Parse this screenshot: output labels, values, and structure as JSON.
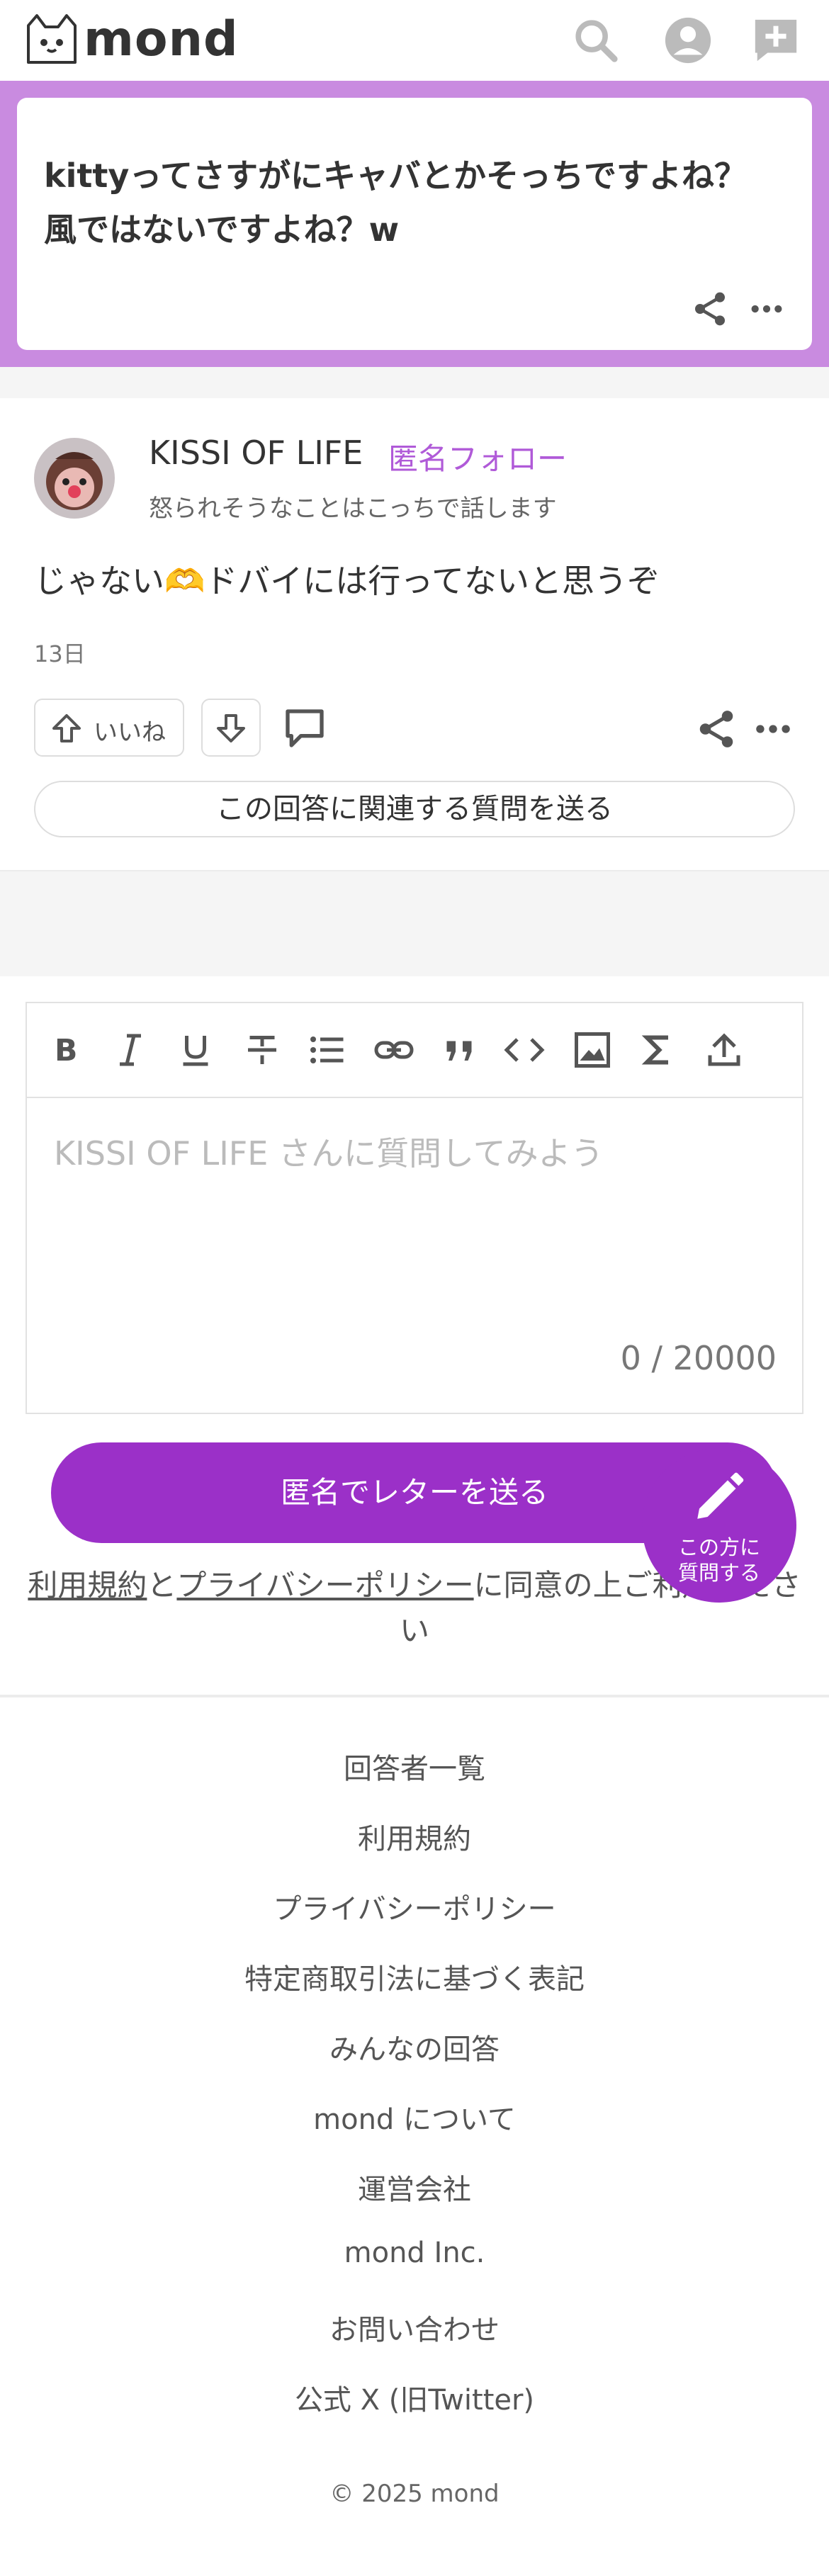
{
  "header": {
    "logo_text": "mond",
    "icons": [
      "search-icon",
      "account-icon",
      "new-question-icon"
    ]
  },
  "question": {
    "line1": "kittyってさすがにキャバとかそっちですよね？",
    "line2": "風ではないですよね？w"
  },
  "answer": {
    "name": "KISSI OF LIFE",
    "follow_label": "匿名フォロー",
    "bio": "怒られそうなことはこっちで話します",
    "text": "じゃない🫶ドバイには行ってないと思うぞ",
    "date": "13日",
    "like_label": "いいね",
    "related_button": "この回答に関連する質問を送る"
  },
  "editor": {
    "toolbar": [
      "bold-icon",
      "italic-icon",
      "underline-icon",
      "strikethrough-icon",
      "bullet-list-icon",
      "link-icon",
      "quote-icon",
      "code-icon",
      "image-icon",
      "sigma-icon",
      "upload-icon"
    ],
    "placeholder": "KISSI OF LIFE さんに質問してみよう",
    "counter": "0 / 20000"
  },
  "send_button": "匿名でレターを送る",
  "agreement": {
    "terms": "利用規約",
    "and": "と",
    "privacy": "プライバシーポリシー",
    "rest": "に同意の上ご利用ください"
  },
  "fab": {
    "line1": "この方に",
    "line2": "質問する"
  },
  "footer": {
    "links": [
      "回答者一覧",
      "利用規約",
      "プライバシーポリシー",
      "特定商取引法に基づく表記",
      "みんなの回答",
      "mond について",
      "運営会社",
      "mond Inc.",
      "お問い合わせ",
      "公式 X (旧Twitter)"
    ],
    "copyright": "© 2025 mond"
  },
  "colors": {
    "accent": "#9b30c8",
    "question_band": "#c98be0",
    "follow": "#b05ad8"
  }
}
